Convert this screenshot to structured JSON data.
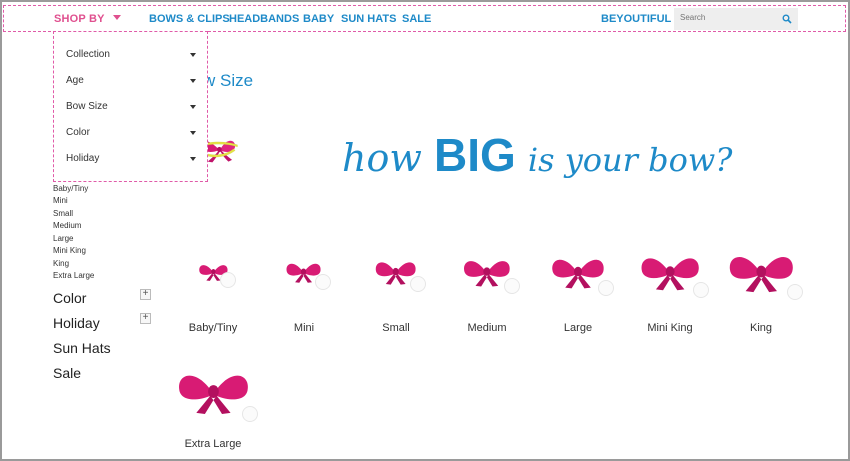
{
  "nav": {
    "shop_by": "SHOP BY",
    "links": [
      "BOWS & CLIPS",
      "HEADBANDS",
      "BABY",
      "SUN HATS",
      "SALE"
    ],
    "brand_link": "BEYOUTIFUL",
    "search_placeholder": "Search"
  },
  "dropdown": {
    "items": [
      "Collection",
      "Age",
      "Bow Size",
      "Color",
      "Holiday"
    ]
  },
  "filters": {
    "sizes": [
      "Baby/Tiny",
      "Mini",
      "Small",
      "Medium",
      "Large",
      "Mini King",
      "King",
      "Extra Large"
    ],
    "categories": [
      "Color",
      "Holiday",
      "Sun Hats",
      "Sale"
    ]
  },
  "main": {
    "title_partial": "w Size",
    "hero_text": {
      "part1": "how",
      "part2": "BIG",
      "part3": "is your bow?"
    },
    "bows": [
      {
        "label": "Baby/Tiny",
        "size": 1
      },
      {
        "label": "Mini",
        "size": 2
      },
      {
        "label": "Small",
        "size": 3
      },
      {
        "label": "Medium",
        "size": 4
      },
      {
        "label": "Large",
        "size": 5
      },
      {
        "label": "Mini King",
        "size": 6
      },
      {
        "label": "King",
        "size": 7
      },
      {
        "label": "Extra Large",
        "size": 8
      }
    ]
  },
  "colors": {
    "pink": "#e0508f",
    "blue": "#1e8ac8",
    "bow": "#d81b74"
  }
}
